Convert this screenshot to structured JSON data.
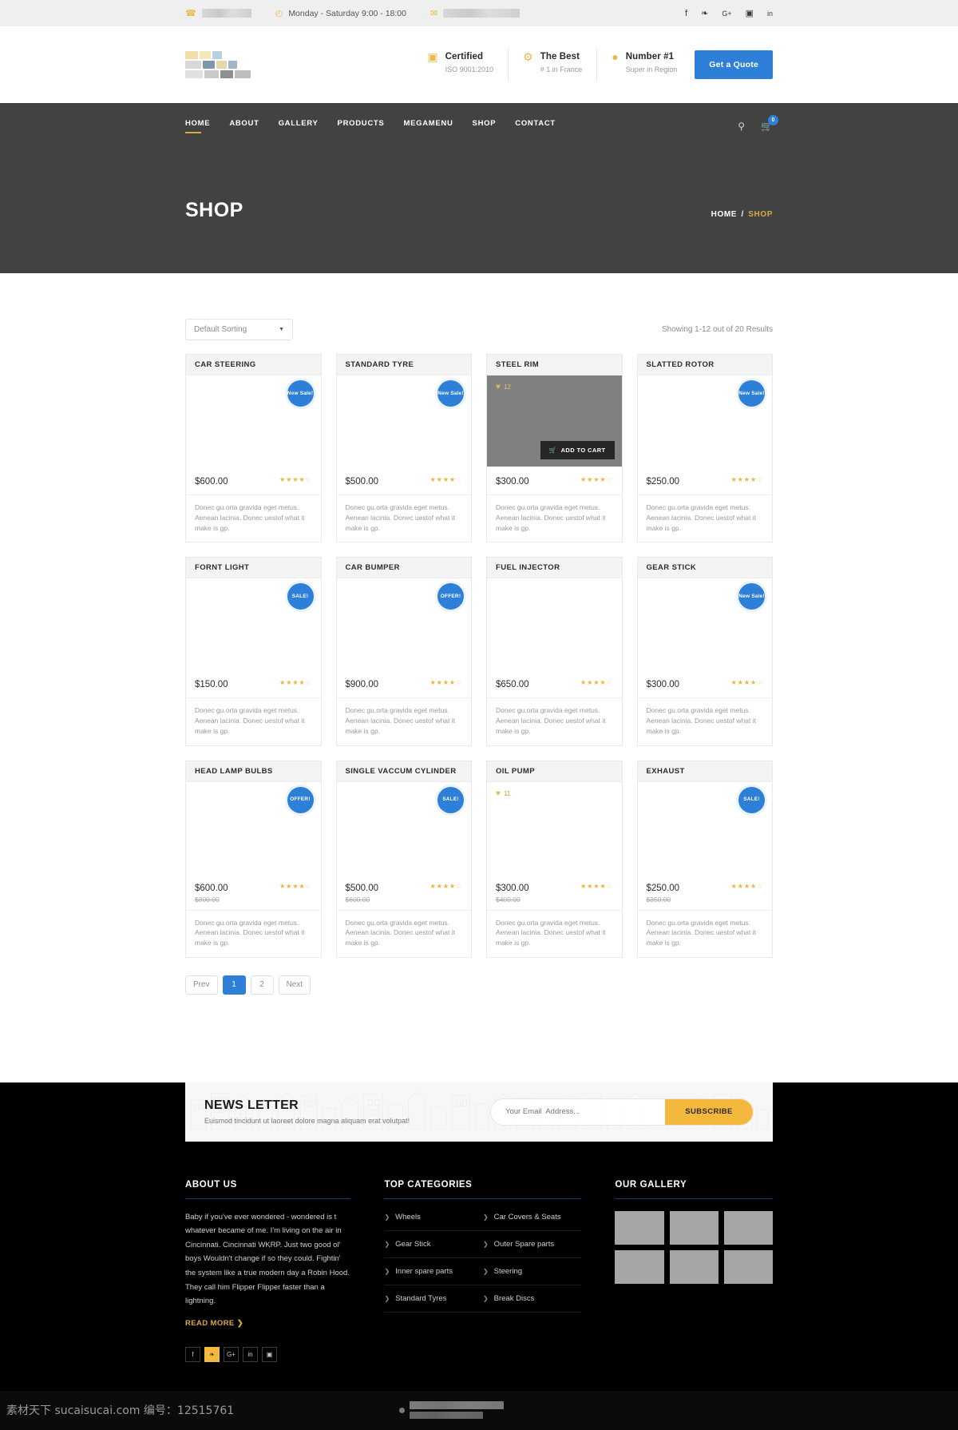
{
  "topbar": {
    "phone_icon": "phone-icon",
    "phone_redacted": true,
    "clock_icon": "clock-icon",
    "hours": "Monday - Saturday 9:00 - 18:00",
    "mail_icon": "envelope-icon",
    "email_redacted": true,
    "social": [
      {
        "name": "facebook-icon",
        "glyph": "f"
      },
      {
        "name": "twitter-icon",
        "glyph": "❧"
      },
      {
        "name": "google-plus-icon",
        "glyph": "G+"
      },
      {
        "name": "instagram-icon",
        "glyph": "▣"
      },
      {
        "name": "linkedin-icon",
        "glyph": "in"
      }
    ]
  },
  "header": {
    "features": [
      {
        "icon": "calendar-icon",
        "title": "Certified",
        "sub": "ISO 9001:2010"
      },
      {
        "icon": "gear-icon",
        "title": "The Best",
        "sub": "# 1 in France"
      },
      {
        "icon": "medal-icon",
        "title": "Number #1",
        "sub": "Super in Region"
      }
    ],
    "quote_button": "Get a Quote"
  },
  "nav": {
    "items": [
      {
        "label": "HOME",
        "active": true
      },
      {
        "label": "ABOUT",
        "active": false
      },
      {
        "label": "GALLERY",
        "active": false
      },
      {
        "label": "PRODUCTS",
        "active": false
      },
      {
        "label": "MEGAMENU",
        "active": false
      },
      {
        "label": "SHOP",
        "active": false
      },
      {
        "label": "CONTACT",
        "active": false
      }
    ],
    "search_icon": "search-icon",
    "cart_icon": "cart-icon",
    "cart_count": "0"
  },
  "hero": {
    "title": "SHOP",
    "breadcrumb_home": "HOME",
    "breadcrumb_sep": "/",
    "breadcrumb_current": "SHOP"
  },
  "shop": {
    "sorting_label": "Default Sorting",
    "results_text": "Showing 1-12 out of 20 Results",
    "add_to_cart_label": "ADD TO CART",
    "description": "Donec gu.orta gravida eget metus. Aenean lacinia. Donec uestof what it make is gp.",
    "products": [
      {
        "title": "CAR STEERING",
        "price": "$600.00",
        "old_price": null,
        "badge": "New Sale!",
        "rating": 4,
        "likes": null,
        "hovered": false
      },
      {
        "title": "STANDARD TYRE",
        "price": "$500.00",
        "old_price": null,
        "badge": "New Sale!",
        "rating": 4,
        "likes": null,
        "hovered": false
      },
      {
        "title": "STEEL RIM",
        "price": "$300.00",
        "old_price": null,
        "badge": null,
        "rating": 4,
        "likes": "12",
        "hovered": true
      },
      {
        "title": "SLATTED ROTOR",
        "price": "$250.00",
        "old_price": null,
        "badge": "New Sale!",
        "rating": 4,
        "likes": null,
        "hovered": false
      },
      {
        "title": "FORNT LIGHT",
        "price": "$150.00",
        "old_price": null,
        "badge": "SALE!",
        "rating": 4,
        "likes": null,
        "hovered": false
      },
      {
        "title": "CAR BUMPER",
        "price": "$900.00",
        "old_price": null,
        "badge": "OFFER!",
        "rating": 4,
        "likes": null,
        "hovered": false
      },
      {
        "title": "FUEL INJECTOR",
        "price": "$650.00",
        "old_price": null,
        "badge": null,
        "rating": 4,
        "likes": null,
        "hovered": false
      },
      {
        "title": "GEAR STICK",
        "price": "$300.00",
        "old_price": null,
        "badge": "New Sale!",
        "rating": 4,
        "likes": null,
        "hovered": false
      },
      {
        "title": "HEAD LAMP BULBS",
        "price": "$600.00",
        "old_price": "$800.00",
        "badge": "OFFER!",
        "rating": 4,
        "likes": null,
        "hovered": false
      },
      {
        "title": "SINGLE VACCUM CYLINDER",
        "price": "$500.00",
        "old_price": "$600.00",
        "badge": "SALE!",
        "rating": 4,
        "likes": null,
        "hovered": false
      },
      {
        "title": "OIL PUMP",
        "price": "$300.00",
        "old_price": "$400.00",
        "badge": null,
        "rating": 4,
        "likes": "11",
        "hovered": false
      },
      {
        "title": "EXHAUST",
        "price": "$250.00",
        "old_price": "$350.00",
        "badge": "SALE!",
        "rating": 4,
        "likes": null,
        "hovered": false
      }
    ],
    "pagination": [
      {
        "label": "Prev",
        "active": false
      },
      {
        "label": "1",
        "active": true
      },
      {
        "label": "2",
        "active": false
      },
      {
        "label": "Next",
        "active": false
      }
    ]
  },
  "newsletter": {
    "title": "NEWS LETTER",
    "subtitle": "Euismod tincidunt ut laoreet dolore magna aliquam erat volutpat!",
    "placeholder": "Your Email  Address...",
    "button": "SUBSCRIBE"
  },
  "footer": {
    "about": {
      "title": "ABOUT US",
      "text": "Baby if you've ever wondered - wondered is t whatever became of me. I'm living on the air in Cincinnati. Cincinnati WKRP. Just two good ol' boys Wouldn't change if so they could. Fightin' the system like a true modern day a Robin Hood. They call him Flipper Flipper faster than a lightning.",
      "read_more": "READ MORE",
      "read_more_arrow": "❯",
      "social": [
        {
          "name": "facebook-icon",
          "glyph": "f",
          "active": false
        },
        {
          "name": "twitter-icon",
          "glyph": "❧",
          "active": true
        },
        {
          "name": "google-plus-icon",
          "glyph": "G+",
          "active": false
        },
        {
          "name": "linkedin-icon",
          "glyph": "in",
          "active": false
        },
        {
          "name": "instagram-icon",
          "glyph": "▣",
          "active": false
        }
      ]
    },
    "categories": {
      "title": "TOP CATEGORIES",
      "items": [
        "Wheels",
        "Car Covers & Seats",
        "Gear Stick",
        "Outer Spare parts",
        "Inner spare parts",
        "Steering",
        "Standard Tyres",
        "Break Discs"
      ]
    },
    "gallery": {
      "title": "OUR GALLERY",
      "count": 6
    }
  },
  "watermark": {
    "text": "素材天下 sucaisucai.com 编号：12515761"
  },
  "colors": {
    "accent_blue": "#2d7fd8",
    "accent_gold": "#d8a93f",
    "hero_gray": "#424242",
    "newsletter_yellow": "#f4b93c"
  }
}
